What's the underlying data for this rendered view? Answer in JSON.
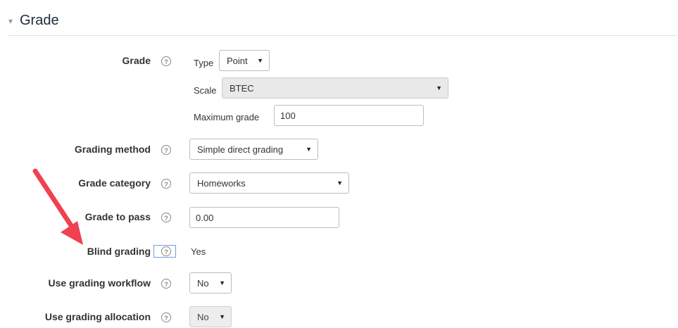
{
  "section": {
    "title": "Grade",
    "caret": "▾"
  },
  "fields": {
    "grade": {
      "label": "Grade",
      "type_label": "Type",
      "type_value": "Point",
      "scale_label": "Scale",
      "scale_value": "BTEC",
      "maximum_label": "Maximum grade",
      "maximum_value": "100"
    },
    "grading_method": {
      "label": "Grading method",
      "value": "Simple direct grading"
    },
    "grade_category": {
      "label": "Grade category",
      "value": "Homeworks"
    },
    "grade_to_pass": {
      "label": "Grade to pass",
      "value": "0.00"
    },
    "blind_grading": {
      "label": "Blind grading",
      "value": "Yes"
    },
    "use_grading_workflow": {
      "label": "Use grading workflow",
      "value": "No"
    },
    "use_grading_allocation": {
      "label": "Use grading allocation",
      "value": "No"
    }
  },
  "icons": {
    "help": "?",
    "dropdown": "▼"
  },
  "colors": {
    "annotation_arrow": "#ef4150",
    "focus_border": "#6ea0d9"
  }
}
